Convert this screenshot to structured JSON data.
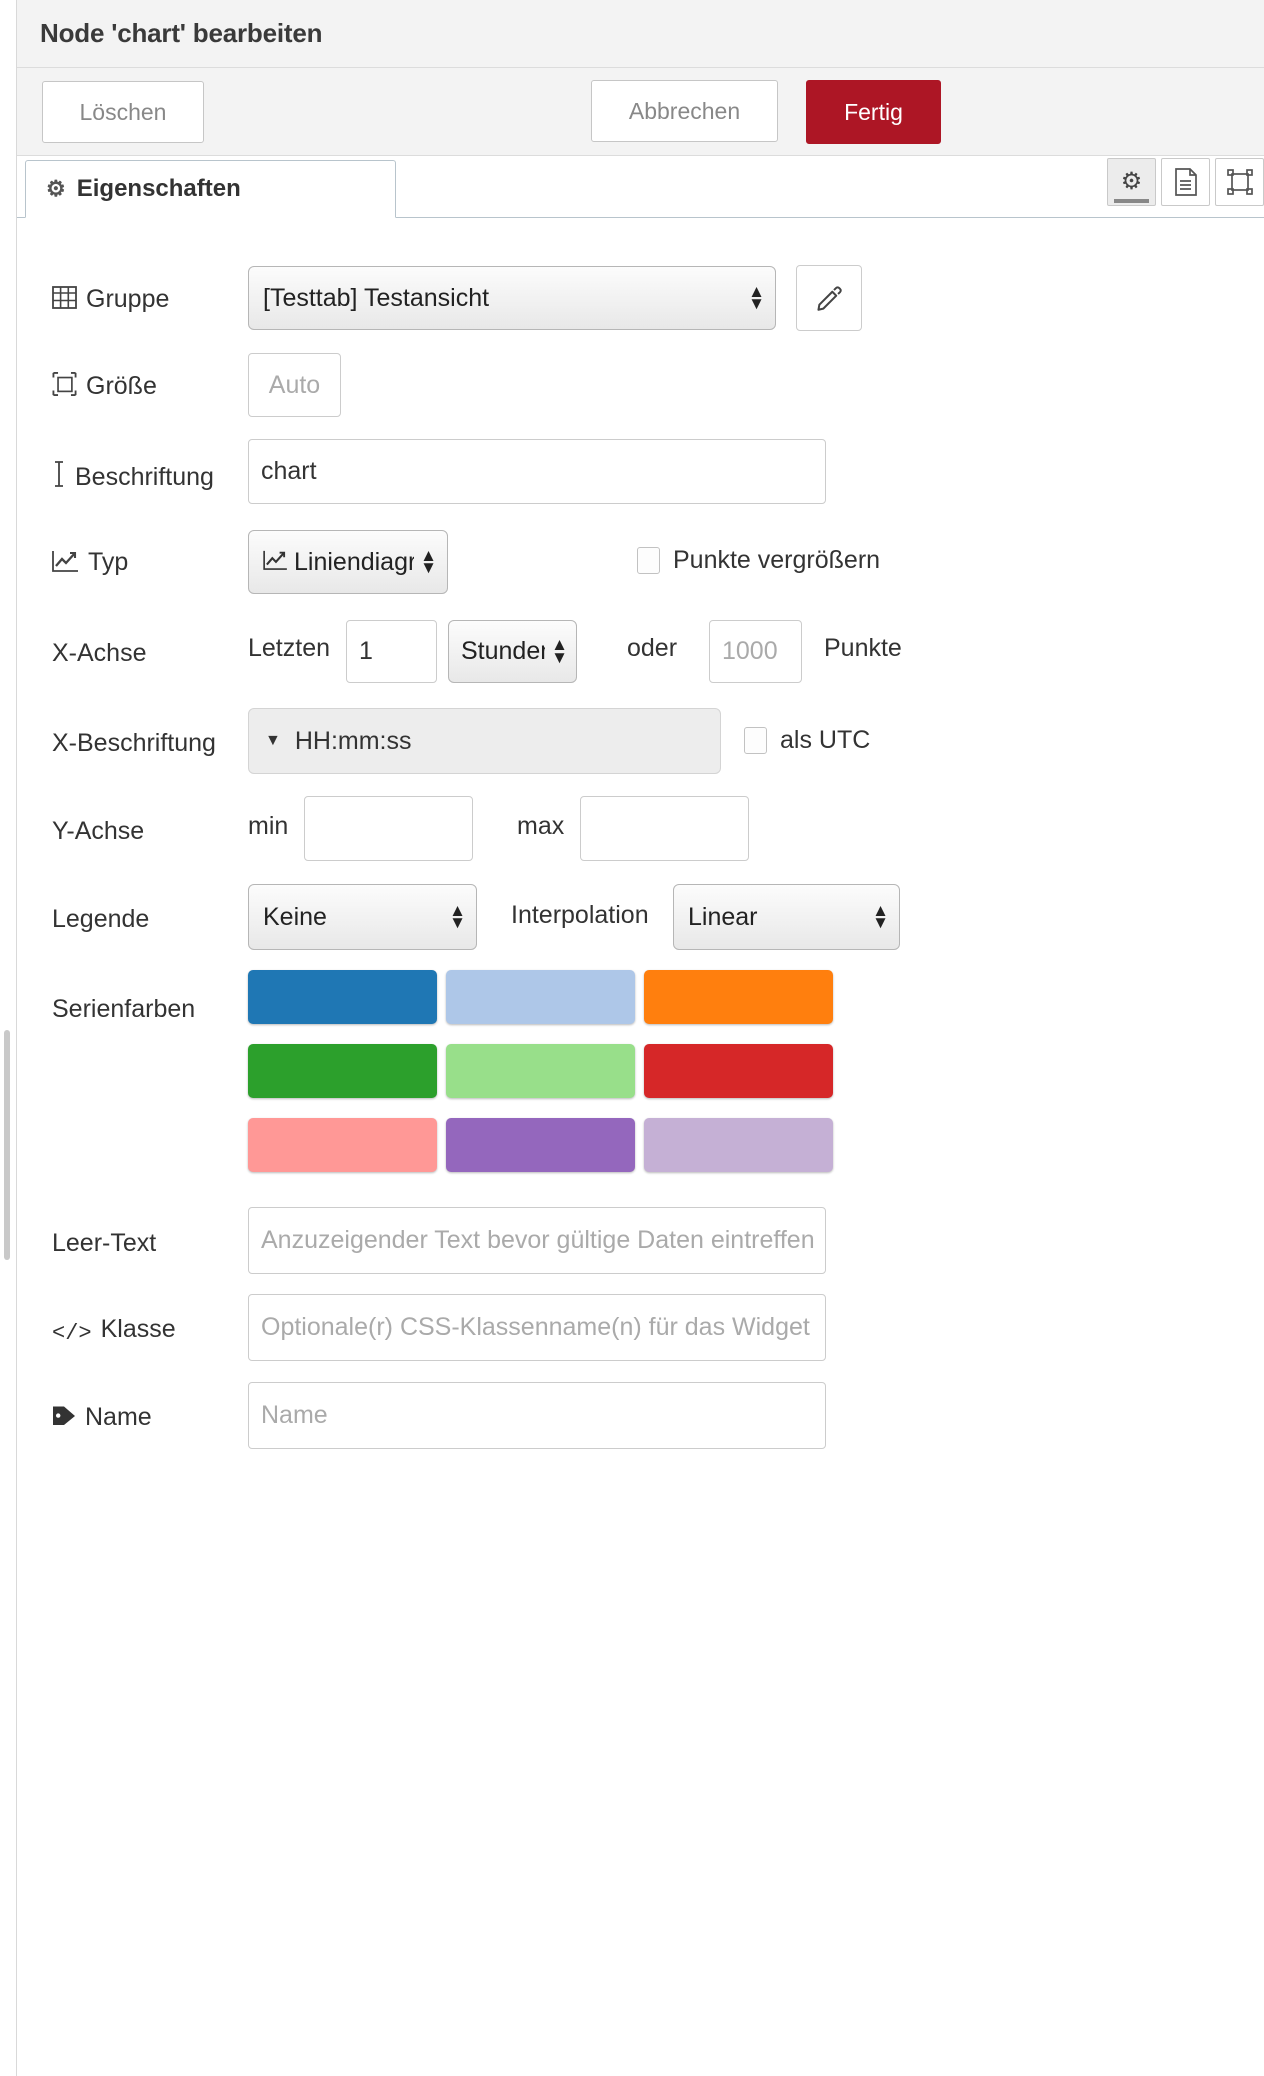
{
  "header": {
    "title": "Node 'chart' bearbeiten"
  },
  "buttons": {
    "delete": "Löschen",
    "cancel": "Abbrechen",
    "done": "Fertig"
  },
  "tabs": {
    "properties": {
      "label": "Eigenschaften",
      "icon": "gear-icon"
    },
    "icon_buttons": [
      {
        "name": "gear-icon",
        "active": true
      },
      {
        "name": "document-icon",
        "active": false
      },
      {
        "name": "appearance-icon",
        "active": false
      }
    ]
  },
  "form": {
    "group": {
      "label": "Gruppe",
      "icon": "table-icon",
      "value": "[Testtab] Testansicht",
      "edit_icon": "pencil-icon"
    },
    "size": {
      "label": "Größe",
      "icon": "resize-icon",
      "value": "Auto"
    },
    "caption": {
      "label": "Beschriftung",
      "icon": "text-cursor-icon",
      "value": "chart"
    },
    "type": {
      "label": "Typ",
      "icon": "line-chart-icon",
      "value": "Liniendiagramm",
      "enlarge_points": {
        "label": "Punkte vergrößern",
        "checked": false
      }
    },
    "xaxis": {
      "label": "X-Achse",
      "prefix": "Letzten",
      "amount": "1",
      "unit": "Stunden",
      "or": "oder",
      "points_placeholder": "1000",
      "points_suffix": "Punkte"
    },
    "xlabel": {
      "label": "X-Beschriftung",
      "value": "HH:mm:ss",
      "utc": {
        "label": "als UTC",
        "checked": false
      }
    },
    "yaxis": {
      "label": "Y-Achse",
      "min_label": "min",
      "min_value": "",
      "max_label": "max",
      "max_value": ""
    },
    "legend": {
      "label": "Legende",
      "value": "Keine"
    },
    "interpolation": {
      "label": "Interpolation",
      "value": "Linear"
    },
    "series_colors": {
      "label": "Serienfarben",
      "colors": [
        "#1f77b4",
        "#aec7e8",
        "#ff7f0e",
        "#2ca02c",
        "#98df8a",
        "#d62728",
        "#ff9896",
        "#9467bd",
        "#c5b0d5"
      ]
    },
    "empty_text": {
      "label": "Leer-Text",
      "placeholder": "Anzuzeigender Text bevor gültige Daten eintreffen",
      "value": ""
    },
    "class": {
      "label": "Klasse",
      "icon": "code-icon",
      "placeholder": "Optionale(r) CSS-Klassenname(n) für das Widget",
      "value": ""
    },
    "name": {
      "label": "Name",
      "icon": "tag-icon",
      "placeholder": "Name",
      "value": ""
    }
  },
  "colors": {
    "accent_done": "#ad1625",
    "header_bg": "#f3f3f3",
    "border": "#cccccc"
  }
}
